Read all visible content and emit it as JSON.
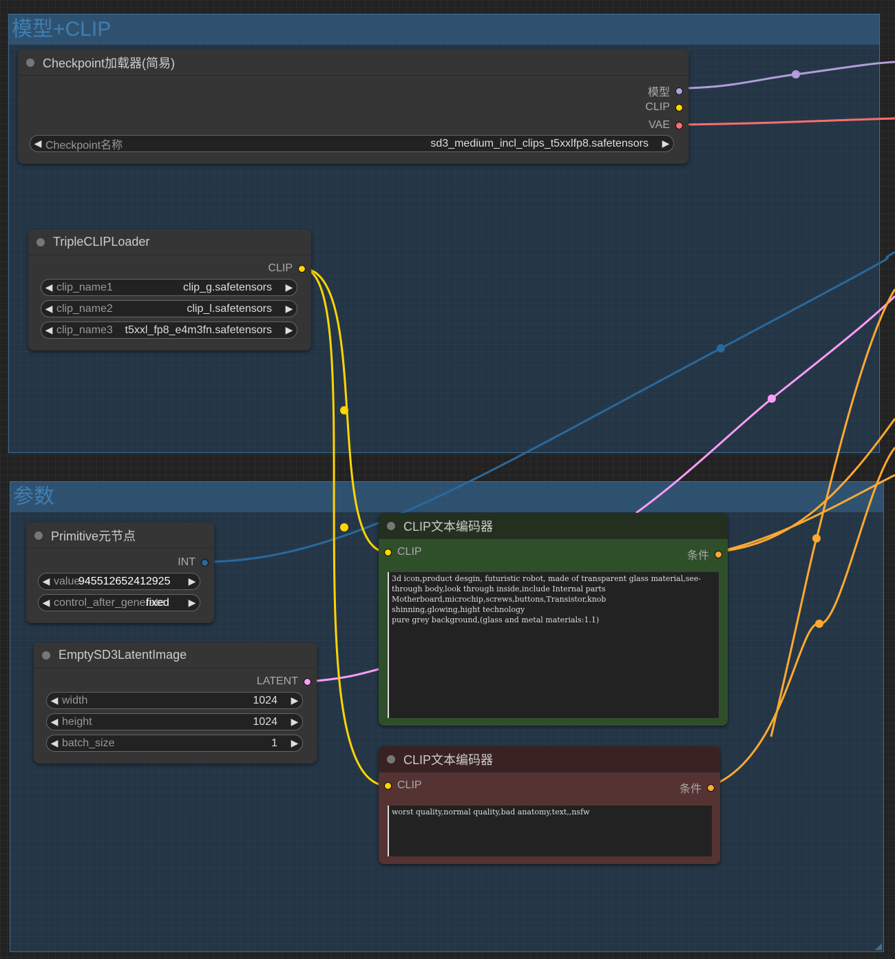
{
  "groups": {
    "model_clip": {
      "title": "模型+CLIP"
    },
    "params": {
      "title": "参数"
    }
  },
  "nodes": {
    "checkpoint": {
      "title": "Checkpoint加载器(简易)",
      "outputs": [
        "模型",
        "CLIP",
        "VAE"
      ],
      "widget_name": "Checkpoint名称",
      "widget_value": "sd3_medium_incl_clips_t5xxlfp8.safetensors"
    },
    "triple_clip": {
      "title": "TripleCLIPLoader",
      "output": "CLIP",
      "widgets": [
        {
          "name": "clip_name1",
          "value": "clip_g.safetensors"
        },
        {
          "name": "clip_name2",
          "value": "clip_l.safetensors"
        },
        {
          "name": "clip_name3",
          "value": "t5xxl_fp8_e4m3fn.safetensors"
        }
      ]
    },
    "primitive": {
      "title": "Primitive元节点",
      "output": "INT",
      "widgets": [
        {
          "name": "value",
          "value": "945512652412925"
        },
        {
          "name": "control_after_generate",
          "value": "fixed"
        }
      ]
    },
    "latent": {
      "title": "EmptySD3LatentImage",
      "output": "LATENT",
      "widgets": [
        {
          "name": "width",
          "value": "1024"
        },
        {
          "name": "height",
          "value": "1024"
        },
        {
          "name": "batch_size",
          "value": "1"
        }
      ]
    },
    "clip_pos": {
      "title": "CLIP文本编码器",
      "input": "CLIP",
      "output": "条件",
      "text": "3d icon,product desgin, futuristic robot, made of transparent glass material,see-through body,look through inside,include Internal parts\nMotherboard,microchip,screws,buttons,Transistor,knob\nshinning,glowing,hight technology\npure grey background,(glass and metal materials:1.1)"
    },
    "clip_neg": {
      "title": "CLIP文本编码器",
      "input": "CLIP",
      "output": "条件",
      "text": "worst quality,normal quality,bad anatomy,text,,nsfw"
    }
  },
  "colors": {
    "model": "#b39ddb",
    "clip": "#ffd500",
    "vae": "#ff6e6e",
    "int": "#29699c",
    "latent": "#ff9cf9",
    "conditioning": "#ffa931",
    "pos_title": "#23301f",
    "pos_body": "#2f4f2a",
    "neg_title": "#3a2222",
    "neg_body": "#553333"
  }
}
